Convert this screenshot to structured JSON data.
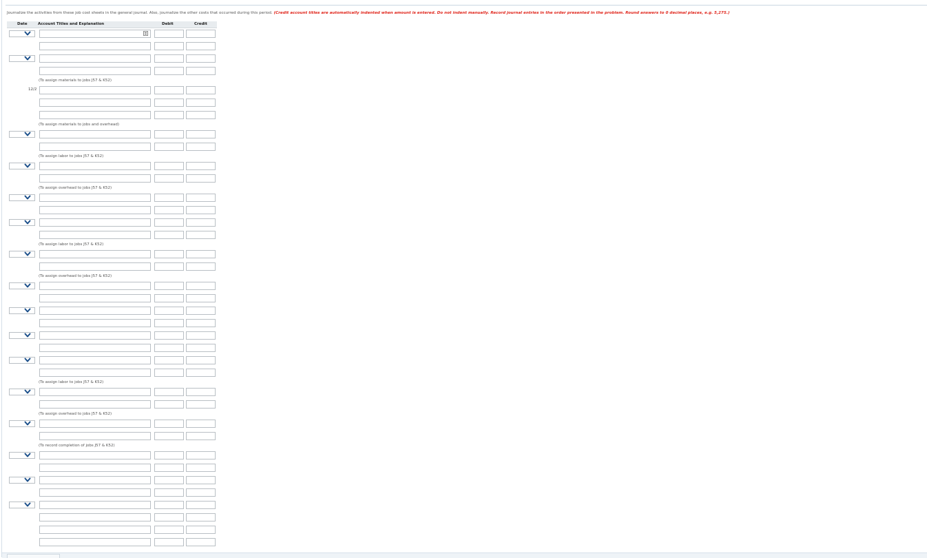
{
  "instructions": {
    "text": "Journalize the activities from these job cost sheets in the general journal. Also, journalize the other costs that occurred during this period. ",
    "emphasis": "(Credit account titles are automatically indented when amount is entered. Do not indent manually. Record journal entries in the order presented in the problem. Round answers to 0 decimal places, e.g. 5,275.)"
  },
  "table": {
    "headers": {
      "date": "Date",
      "account": "Account Titles and Explanation",
      "debit": "Debit",
      "credit": "Credit"
    }
  },
  "dates": {
    "entry_3": "12/2"
  },
  "explanations": {
    "e1": "(To assign materials to jobs J57 & K52)",
    "e2": "(To assign materials to jobs and overhead)",
    "e3": "(To assign labor to jobs J57 & K52)",
    "e4": "(To assign overhead to jobs J57 & K52)",
    "e5": "(To assign labor to jobs J57 & K52)",
    "e6": "(To assign overhead to jobs J57 & K52)",
    "e7": "(To assign labor to jobs J57 & K52)",
    "e8": "(To assign overhead to jobs J57 & K52)",
    "e9": "(To record completion of jobs J57 & K52)"
  },
  "icons": {
    "dropdown": "chevron-down-icon",
    "account_list": "account-list-icon"
  }
}
